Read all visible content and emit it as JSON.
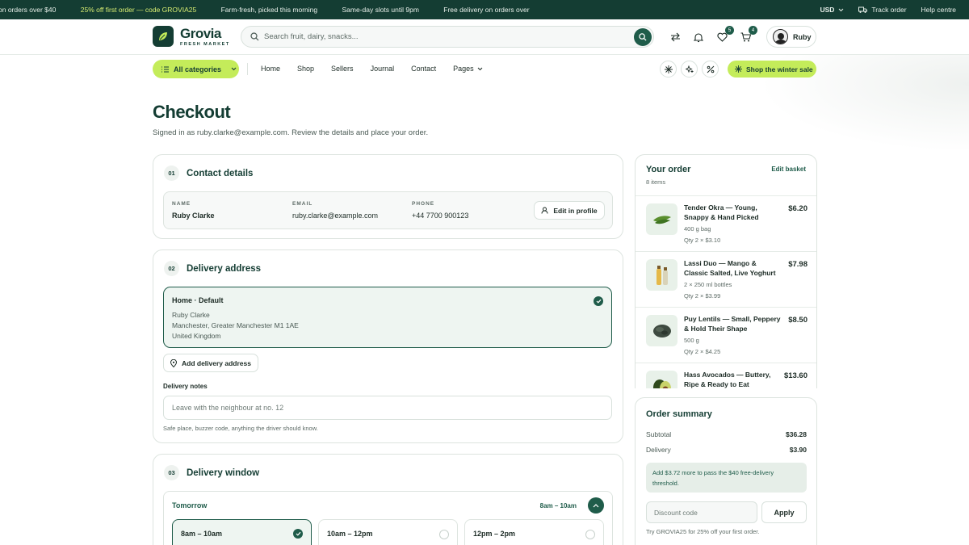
{
  "announcements": [
    "on orders over $40",
    "25% off first order — code GROVIA25",
    "Farm-fresh, picked this morning",
    "Same-day slots until 9pm",
    "Free delivery on orders over"
  ],
  "topbar": {
    "currency": "USD",
    "track": "Track order",
    "help": "Help centre"
  },
  "brand": {
    "name": "Grovia",
    "tagline": "FRESH MARKET"
  },
  "search": {
    "placeholder": "Search fruit, dairy, snacks..."
  },
  "header": {
    "wishlist_count": "5",
    "cart_count": "4",
    "user": "Ruby"
  },
  "nav": {
    "all_categories": "All categories",
    "links": [
      "Home",
      "Shop",
      "Sellers",
      "Journal",
      "Contact",
      "Pages"
    ],
    "sale": "Shop the winter sale"
  },
  "page": {
    "title": "Checkout",
    "subtitle": "Signed in as ruby.clarke@example.com. Review the details and place your order."
  },
  "contact": {
    "step": "01",
    "title": "Contact details",
    "name_label": "NAME",
    "name": "Ruby Clarke",
    "email_label": "EMAIL",
    "email": "ruby.clarke@example.com",
    "phone_label": "PHONE",
    "phone": "+44 7700 900123",
    "edit": "Edit in profile"
  },
  "address": {
    "step": "02",
    "title": "Delivery address",
    "selected_title": "Home · Default",
    "lines": [
      "Ruby Clarke",
      "Manchester, Greater Manchester M1 1AE",
      "United Kingdom"
    ],
    "add": "Add delivery address",
    "notes_label": "Delivery notes",
    "notes_placeholder": "Leave with the neighbour at no. 12",
    "notes_help": "Safe place, buzzer code, anything the driver should know."
  },
  "window": {
    "step": "03",
    "title": "Delivery window",
    "day": "Tomorrow",
    "selected": "8am – 10am",
    "slots": [
      "8am – 10am",
      "10am – 12pm",
      "12pm – 2pm"
    ]
  },
  "order": {
    "title": "Your order",
    "count": "8 items",
    "edit": "Edit basket",
    "items": [
      {
        "name": "Tender Okra — Young, Snappy & Hand Picked",
        "size": "400 g bag",
        "qty": "Qty 2 × $3.10",
        "price": "$6.20"
      },
      {
        "name": "Lassi Duo — Mango & Classic Salted, Live Yoghurt",
        "size": "2 × 250 ml bottles",
        "qty": "Qty 2 × $3.99",
        "price": "$7.98"
      },
      {
        "name": "Puy Lentils — Small, Peppery & Hold Their Shape",
        "size": "500 g",
        "qty": "Qty 2 × $4.25",
        "price": "$8.50"
      },
      {
        "name": "Hass Avocados — Buttery, Ripe & Ready to Eat",
        "size": "",
        "qty": "",
        "price": "$13.60"
      }
    ]
  },
  "summary": {
    "title": "Order summary",
    "subtotal_label": "Subtotal",
    "subtotal": "$36.28",
    "delivery_label": "Delivery",
    "delivery": "$3.90",
    "notice": "Add $3.72 more to pass the $40 free-delivery threshold.",
    "discount_placeholder": "Discount code",
    "apply": "Apply",
    "hint": "Try GROVIA25 for 25% off your first order."
  },
  "colors": {
    "brand": "#143d33",
    "accent": "#c4ec5a",
    "primary": "#1f5c4a"
  }
}
